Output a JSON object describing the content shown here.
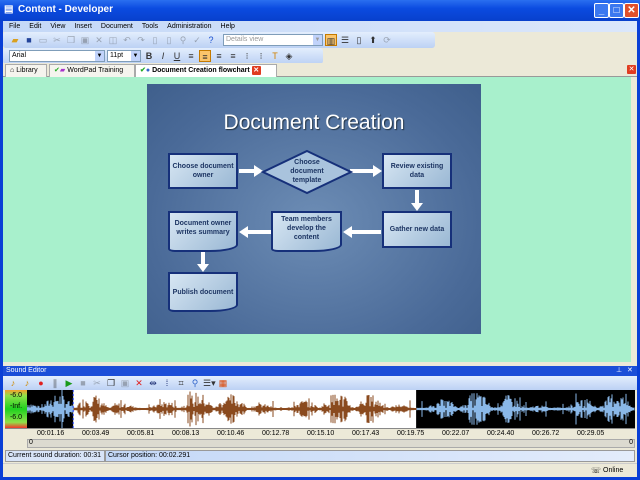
{
  "window": {
    "title": "Content - Developer"
  },
  "menu": [
    "File",
    "Edit",
    "View",
    "Insert",
    "Document",
    "Tools",
    "Administration",
    "Help"
  ],
  "toolbar": {
    "view_combo": "Details view"
  },
  "format": {
    "font": "Arial",
    "size": "11pt",
    "bold": "B",
    "italic": "I",
    "underline": "U"
  },
  "tabs": [
    {
      "label": "Library"
    },
    {
      "label": "WordPad Training"
    },
    {
      "label": "Document Creation flowchart"
    }
  ],
  "slide": {
    "title": "Document Creation",
    "steps": [
      "Choose document owner",
      "Choose document template",
      "Review existing data",
      "Gather new data",
      "Team members develop the content",
      "Document owner writes summary",
      "Publish document"
    ]
  },
  "sound_editor": {
    "title": "Sound Editor",
    "meter": [
      "-6.0",
      "-Inf.",
      "-6.0"
    ],
    "timeline": [
      "00:01.16",
      "00:03.49",
      "00:05.81",
      "00:08.13",
      "00:10.46",
      "00:12.78",
      "00:15.10",
      "00:17.43",
      "00:19.75",
      "00:22.07",
      "00:24.40",
      "00:26.72",
      "00:29.05"
    ],
    "scroll_start": "0",
    "scroll_end": "0",
    "duration": "Current sound duration: 00:31",
    "cursor": "Cursor position: 00:02.291",
    "selection": {
      "start_fraction": 0.076,
      "end_fraction": 0.64
    }
  },
  "statusbar": {
    "online": "Online"
  }
}
